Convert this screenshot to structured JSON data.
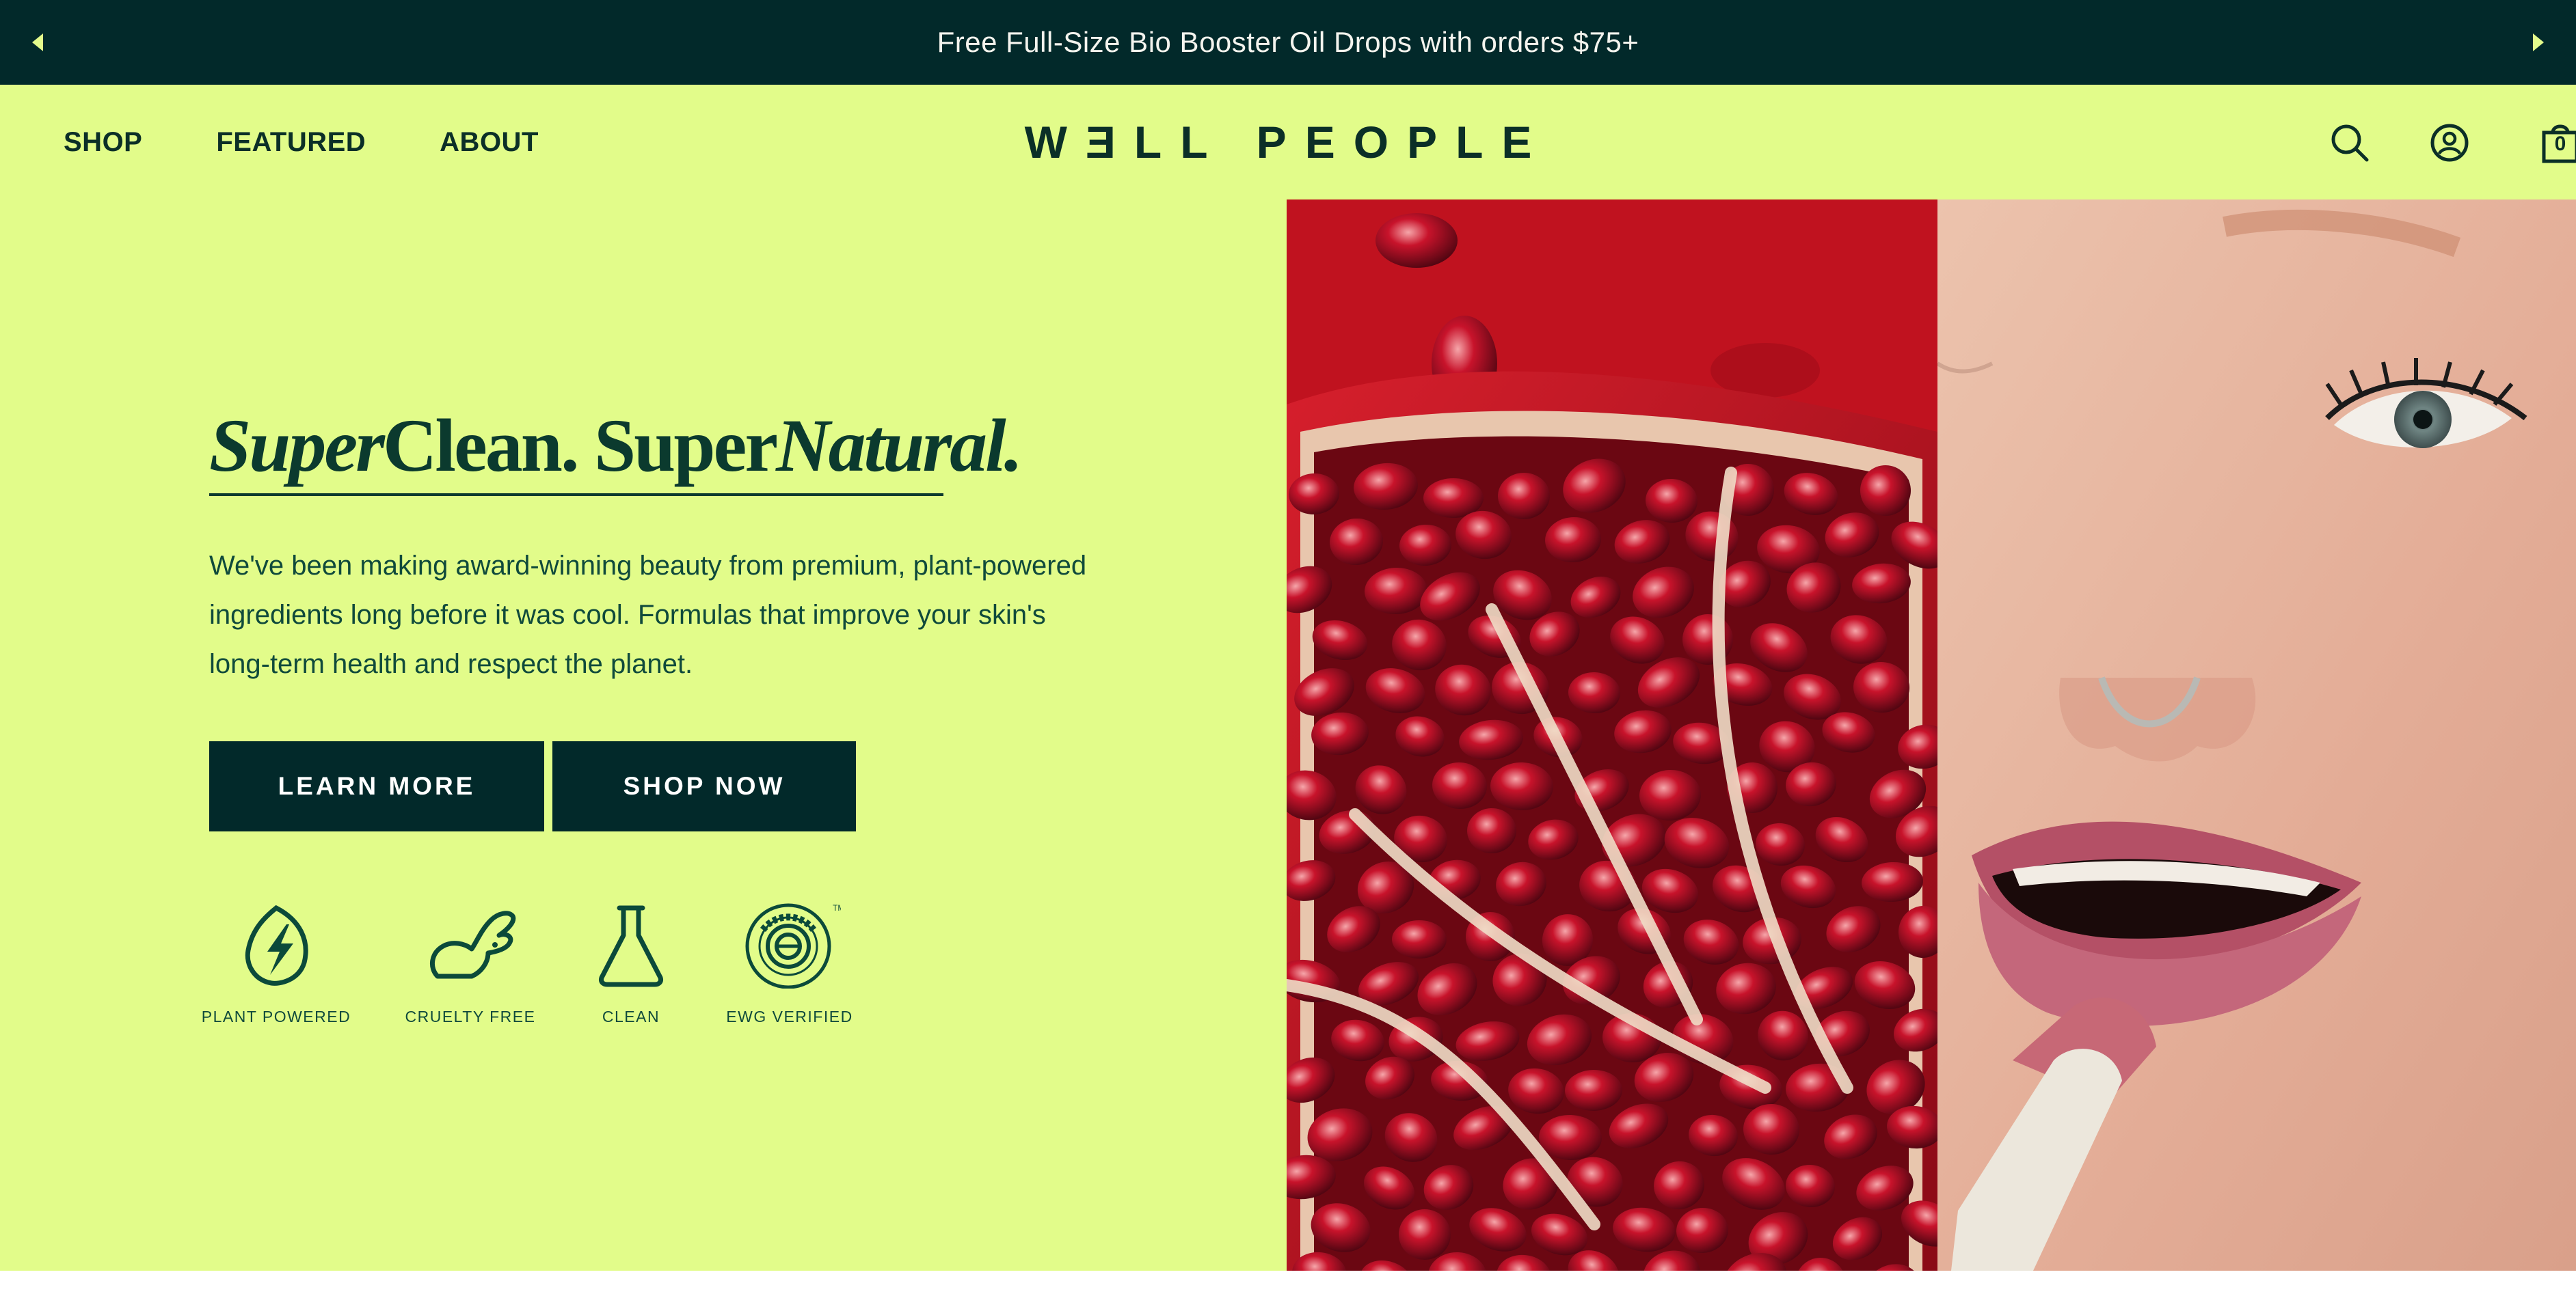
{
  "announcement": {
    "message": "Free Full-Size Bio Booster Oil Drops with orders $75+",
    "prev_icon": "caret-left-icon",
    "next_icon": "caret-right-icon"
  },
  "header": {
    "nav": [
      "SHOP",
      "FEATURED",
      "ABOUT"
    ],
    "logo": "WƎLL PEOPLE",
    "icons": [
      "search-icon",
      "account-icon",
      "cart-icon"
    ],
    "cart_count": "0"
  },
  "hero": {
    "headline": {
      "part1": "Super",
      "part2": "Clean. Super",
      "part3": "Natural."
    },
    "body": "We've been making award-winning beauty from premium, plant-powered ingredients long before it was cool. Formulas that improve your skin's long-term health and respect the planet.",
    "buttons": {
      "learn_more": "LEARN MORE",
      "shop_now": "SHOP NOW"
    },
    "badges": [
      {
        "label": "PLANT POWERED",
        "icon": "leaf-bolt-icon"
      },
      {
        "label": "CRUELTY FREE",
        "icon": "rabbit-icon"
      },
      {
        "label": "CLEAN",
        "icon": "flask-icon"
      },
      {
        "label": "EWG VERIFIED",
        "icon": "ewg-verified-seal-icon",
        "seal_text": "EWG VERIFIED",
        "trademark": "TM"
      }
    ]
  },
  "colors": {
    "announcement_bg": "#02292a",
    "accent_lime": "#e2fc8a",
    "dark_green": "#0b3a2e",
    "button_bg": "#02292a"
  }
}
